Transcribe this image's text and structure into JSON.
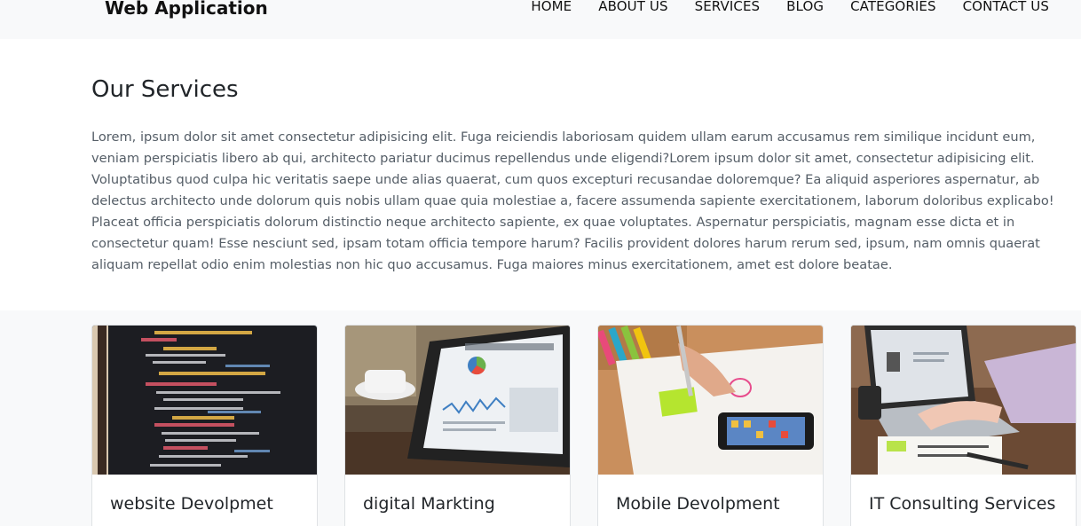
{
  "header": {
    "brand": "Web Application",
    "nav": [
      "HOME",
      "ABOUT US",
      "SERVICES",
      "BLOG",
      "CATEGORIES",
      "CONTACT US"
    ]
  },
  "services": {
    "title": "Our Services",
    "description": "Lorem, ipsum dolor sit amet consectetur adipisicing elit. Fuga reiciendis laboriosam quidem ullam earum accusamus rem similique incidunt eum, veniam perspiciatis libero ab qui, architecto pariatur ducimus repellendus unde eligendi?Lorem ipsum dolor sit amet, consectetur adipisicing elit. Voluptatibus quod culpa hic veritatis saepe unde alias quaerat, cum quos excepturi recusandae doloremque? Ea aliquid asperiores aspernatur, ab delectus architecto unde dolorum quis nobis ullam quae quia molestiae a, facere assumenda sapiente exercitationem, laborum doloribus explicabo! Placeat officia perspiciatis dolorum distinctio neque architecto sapiente, ex quae voluptates. Aspernatur perspiciatis, magnam esse dicta et in consectetur quam! Esse nesciunt sed, ipsam totam officia tempore harum? Facilis provident dolores harum rerum sed, ipsum, nam omnis quaerat aliquam repellat odio enim molestias non hic quo accusamus. Fuga maiores minus exercitationem, amet est dolore beatae."
  },
  "cards": [
    {
      "title": "website Devolpmet",
      "image": "code-screen-photo"
    },
    {
      "title": "digital Markting",
      "image": "tablet-analytics-photo"
    },
    {
      "title": "Mobile Devolpment",
      "image": "sketching-wireframes-photo"
    },
    {
      "title": "IT Consulting Services",
      "image": "laptop-typing-photo"
    }
  ]
}
